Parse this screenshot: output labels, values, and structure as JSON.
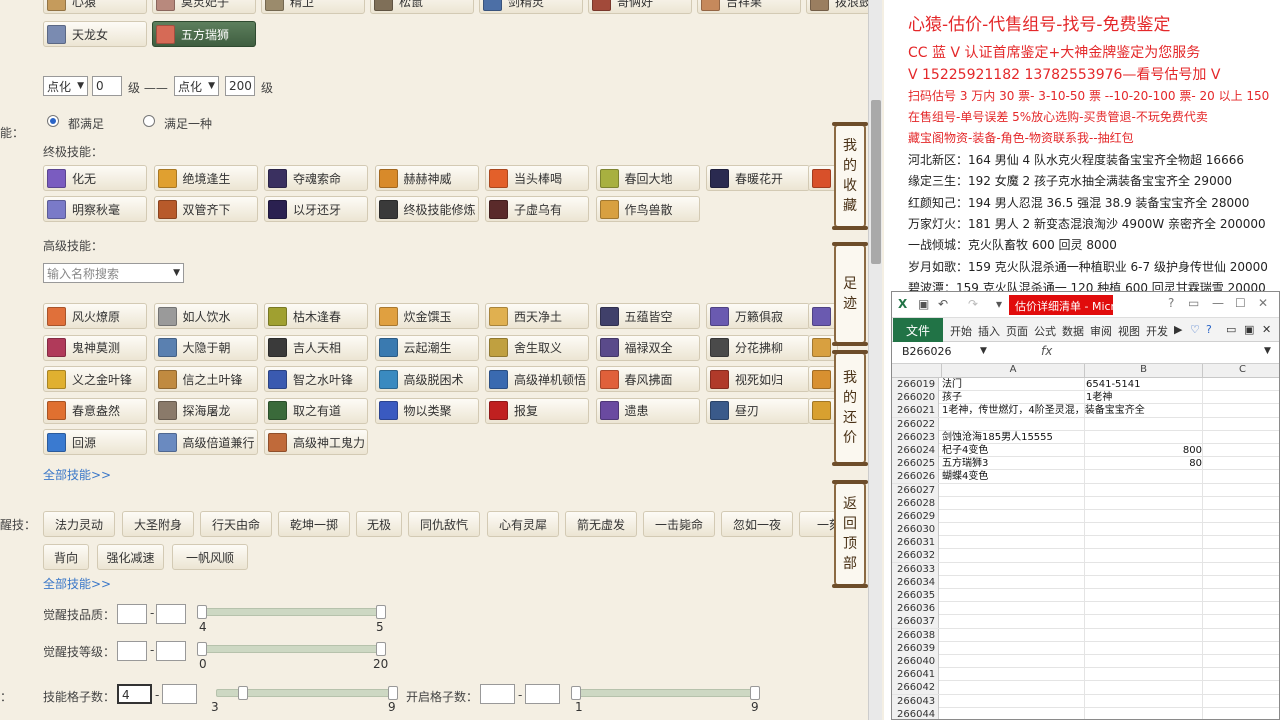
{
  "top_row_items": [
    {
      "label": "心猿",
      "color": "#c59b5c"
    },
    {
      "label": "莫灵妃子",
      "color": "#b8897d"
    },
    {
      "label": "精卫",
      "color": "#9b8b6c"
    },
    {
      "label": "松鼠",
      "color": "#7f6f58"
    },
    {
      "label": "剑精灵",
      "color": "#4c6fa6"
    },
    {
      "label": "哥俩好",
      "color": "#a24a3a"
    },
    {
      "label": "吉祥果",
      "color": "#c6895c"
    },
    {
      "label": "拨浪鼓",
      "color": "#9a7e60"
    }
  ],
  "pets_row2": [
    {
      "label": "天龙女",
      "color": "#7a8bb1",
      "selected": false
    },
    {
      "label": "五方瑞狮",
      "color": "#d66a56",
      "selected": true
    }
  ],
  "level_filter": {
    "select1": "点化",
    "input1": "0",
    "mid_text": "级 ——",
    "select2": "点化",
    "input2": "200",
    "suffix": "级"
  },
  "match_mode": {
    "prefix": "能：",
    "opt1": "都满足",
    "opt2": "满足一种"
  },
  "ultimate_skills": {
    "title": "终极技能：",
    "row1": [
      {
        "label": "化无",
        "color": "#7a5cc0"
      },
      {
        "label": "绝境逢生",
        "color": "#e0a030"
      },
      {
        "label": "夺魂索命",
        "color": "#3a3060"
      },
      {
        "label": "赫赫神威",
        "color": "#d88a2a"
      },
      {
        "label": "当头棒喝",
        "color": "#e3602a"
      },
      {
        "label": "春回大地",
        "color": "#a8b040"
      },
      {
        "label": "春暖花开",
        "color": "#2a2a50"
      }
    ],
    "row2": [
      {
        "label": "明察秋毫",
        "color": "#7a7ac8"
      },
      {
        "label": "双管齐下",
        "color": "#b85a2a"
      },
      {
        "label": "以牙还牙",
        "color": "#2a2050"
      },
      {
        "label": "终极技能修炼",
        "color": "#3a3a3a"
      },
      {
        "label": "子虚乌有",
        "color": "#5a2a2a"
      },
      {
        "label": "作鸟兽散",
        "color": "#d8a040"
      }
    ]
  },
  "advanced_skills": {
    "title": "高级技能：",
    "search_placeholder": "输入名称搜索",
    "rows": [
      [
        {
          "label": "风火燎原",
          "color": "#e0703a"
        },
        {
          "label": "如人饮水",
          "color": "#9a9a9a"
        },
        {
          "label": "枯木逢春",
          "color": "#a0a030"
        },
        {
          "label": "炊金馔玉",
          "color": "#e0a040"
        },
        {
          "label": "西天净土",
          "color": "#e0b050"
        },
        {
          "label": "五蕴皆空",
          "color": "#40406a"
        },
        {
          "label": "万籁俱寂",
          "color": "#6a5ab0"
        }
      ],
      [
        {
          "label": "鬼神莫测",
          "color": "#b03a5a"
        },
        {
          "label": "大隐于朝",
          "color": "#5a80b0"
        },
        {
          "label": "吉人天相",
          "color": "#3a3a3a"
        },
        {
          "label": "云起潮生",
          "color": "#3a7ab0"
        },
        {
          "label": "舍生取义",
          "color": "#c0a040"
        },
        {
          "label": "福禄双全",
          "color": "#5a4a8a"
        },
        {
          "label": "分花拂柳",
          "color": "#4a4a4a"
        }
      ],
      [
        {
          "label": "义之金叶锋",
          "color": "#e0b030"
        },
        {
          "label": "信之土叶锋",
          "color": "#c08a40"
        },
        {
          "label": "智之水叶锋",
          "color": "#3a5ab0"
        },
        {
          "label": "高级脱困术",
          "color": "#3a8ac0"
        },
        {
          "label": "高级禅机顿悟",
          "color": "#3a6ab0"
        },
        {
          "label": "春风拂面",
          "color": "#e0603a"
        },
        {
          "label": "视死如归",
          "color": "#b03a2a"
        }
      ],
      [
        {
          "label": "春意盎然",
          "color": "#e07030"
        },
        {
          "label": "探海屠龙",
          "color": "#8a7a6a"
        },
        {
          "label": "取之有道",
          "color": "#3a6a3a"
        },
        {
          "label": "物以类聚",
          "color": "#3a5ac0"
        },
        {
          "label": "报复",
          "color": "#c02020"
        },
        {
          "label": "遗患",
          "color": "#6a4aa0"
        },
        {
          "label": "昼刃",
          "color": "#3a5a8a"
        }
      ],
      [
        {
          "label": "回源",
          "color": "#3a7ad0"
        },
        {
          "label": "高级倍道兼行",
          "color": "#6a8ac0"
        },
        {
          "label": "高级神工鬼力",
          "color": "#c06a3a"
        }
      ]
    ],
    "more_link": "全部技能>>"
  },
  "awaken_skills": {
    "prefix": "醒技：",
    "row1": [
      "法力灵动",
      "大圣附身",
      "行天由命",
      "乾坤一掷",
      "无极",
      "同仇敌忾",
      "心有灵犀",
      "箭无虚发",
      "一击毙命",
      "忽如一夜",
      "一刻"
    ],
    "row2": [
      "背向",
      "强化减速",
      "一帆风顺"
    ],
    "more_link": "全部技能>>"
  },
  "awaken_quality": {
    "label": "觉醒技品质：",
    "min": "4",
    "max": "5"
  },
  "awaken_level": {
    "label": "觉醒技等级：",
    "min": "0",
    "max": "20"
  },
  "skill_slots": {
    "prefix": "：",
    "label": "技能格子数：",
    "input_value": "4",
    "min": "3",
    "max": "9",
    "open_label": "开启格子数：",
    "open_min": "1",
    "open_max": "9"
  },
  "side_nav": [
    "我的收藏",
    "足迹",
    "我的还价",
    "返回顶部"
  ],
  "ad_panel": {
    "headline": "心猿-估价-代售组号-找号-免费鉴定",
    "line_cc": "CC 蓝 V 认证首席鉴定+大神金牌鉴定为您服务",
    "line_contact": "V 15225921182 13782553976—看号估号加 V",
    "line_price": "扫码估号 3 万内 30 票- 3-10-50 票 --10-20-100 票- 20 以上 150",
    "line_sell": "在售组号-单号误差 5%放心选购-买贵管退-不玩免费代卖",
    "line_shop": "藏宝阁物资-装备-角色-物资联系我--抽红包",
    "listings": [
      "河北新区：164 男仙 4 队水克火程度装备宝宝齐全物超 16666",
      "缘定三生：192 女魔 2 孩子克水抽全满装备宝宝齐全 29000",
      "红颜知己：194 男人忍混 36.5 强混 38.9 装备宝宝齐全 28000",
      "万家灯火：181 男人 2 新变态混浪淘沙 4900W 亲密齐全 200000",
      "一战倾城：克火队畜牧 600 回灵 8000",
      "岁月如歌：159 克火队混杀通一种植职业 6-7 级护身传世仙 20000",
      "碧波潭：159 克火队混杀通一 120 种植 600 回灵甘霖瑞雪 20000"
    ]
  },
  "excel": {
    "title": "估价详细清单 - Micro...",
    "file_tab": "文件",
    "tabs": [
      "开始",
      "插入",
      "页面",
      "公式",
      "数据",
      "审阅",
      "视图",
      "开发"
    ],
    "name_box": "B266026",
    "fx": "fx",
    "columns": [
      "A",
      "B",
      "C"
    ],
    "rows": [
      {
        "n": "266019",
        "a": "法门",
        "b": "6541-5141",
        "br": ""
      },
      {
        "n": "266020",
        "a": "孩子",
        "b": "1老神",
        "br": ""
      },
      {
        "n": "266021",
        "a": "1老神，传世燃灯，4阶圣灵混，装备宝宝齐全",
        "b": "",
        "br": ""
      },
      {
        "n": "266022",
        "a": "",
        "b": "",
        "br": ""
      },
      {
        "n": "266023",
        "a": "剑蚀沧海185男人15555",
        "b": "",
        "br": ""
      },
      {
        "n": "266024",
        "a": "杞子4变色",
        "b": "",
        "br": "800"
      },
      {
        "n": "266025",
        "a": "五方瑞狮3",
        "b": "",
        "br": "80"
      },
      {
        "n": "266026",
        "a": "蝴蝶4变色",
        "b": "",
        "br": ""
      },
      {
        "n": "266027",
        "a": "",
        "b": "",
        "br": ""
      },
      {
        "n": "266028",
        "a": "",
        "b": "",
        "br": ""
      },
      {
        "n": "266029",
        "a": "",
        "b": "",
        "br": ""
      },
      {
        "n": "266030",
        "a": "",
        "b": "",
        "br": ""
      },
      {
        "n": "266031",
        "a": "",
        "b": "",
        "br": ""
      },
      {
        "n": "266032",
        "a": "",
        "b": "",
        "br": ""
      },
      {
        "n": "266033",
        "a": "",
        "b": "",
        "br": ""
      },
      {
        "n": "266034",
        "a": "",
        "b": "",
        "br": ""
      },
      {
        "n": "266035",
        "a": "",
        "b": "",
        "br": ""
      },
      {
        "n": "266036",
        "a": "",
        "b": "",
        "br": ""
      },
      {
        "n": "266037",
        "a": "",
        "b": "",
        "br": ""
      },
      {
        "n": "266038",
        "a": "",
        "b": "",
        "br": ""
      },
      {
        "n": "266039",
        "a": "",
        "b": "",
        "br": ""
      },
      {
        "n": "266040",
        "a": "",
        "b": "",
        "br": ""
      },
      {
        "n": "266041",
        "a": "",
        "b": "",
        "br": ""
      },
      {
        "n": "266042",
        "a": "",
        "b": "",
        "br": ""
      },
      {
        "n": "266043",
        "a": "",
        "b": "",
        "br": ""
      },
      {
        "n": "266044",
        "a": "",
        "b": "",
        "br": ""
      }
    ]
  }
}
